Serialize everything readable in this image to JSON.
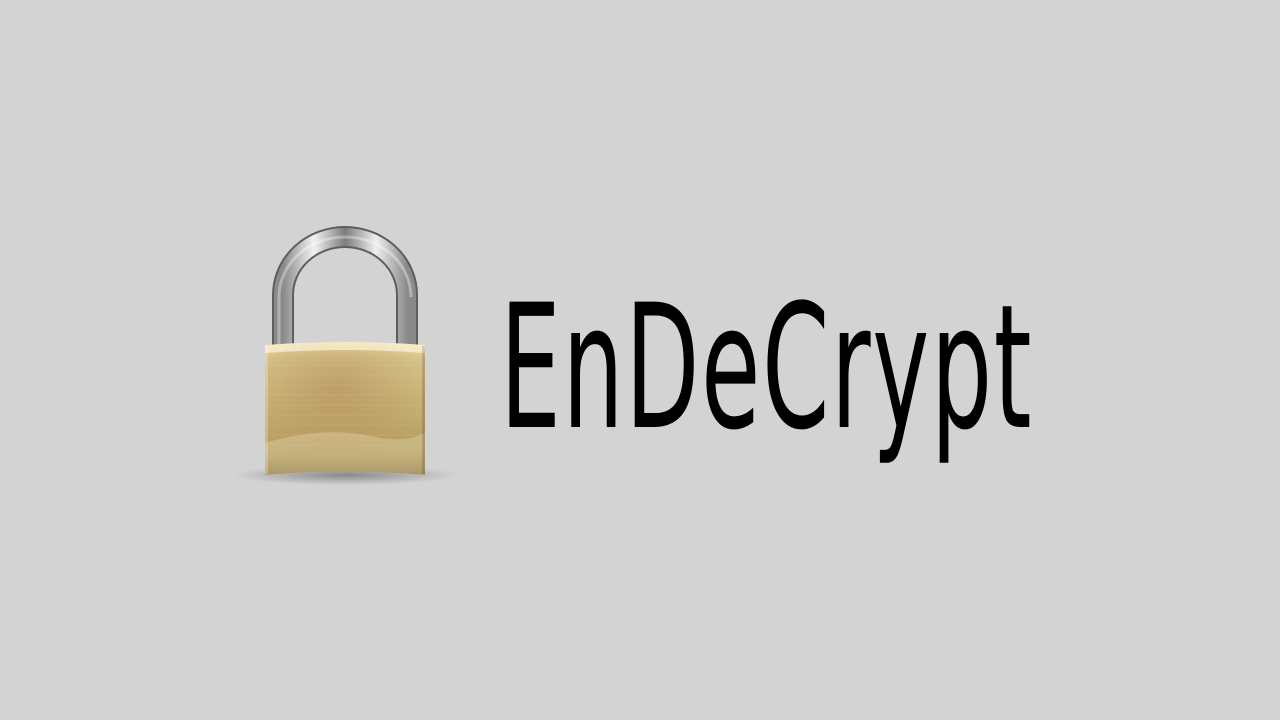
{
  "app": {
    "title": "EnDeCrypt"
  },
  "logo": {
    "icon": "padlock-icon",
    "body_color": "#c9b679",
    "shackle_color": "#c0c0c0"
  },
  "colors": {
    "background": "#d3d3d3",
    "title_text": "#000000"
  }
}
